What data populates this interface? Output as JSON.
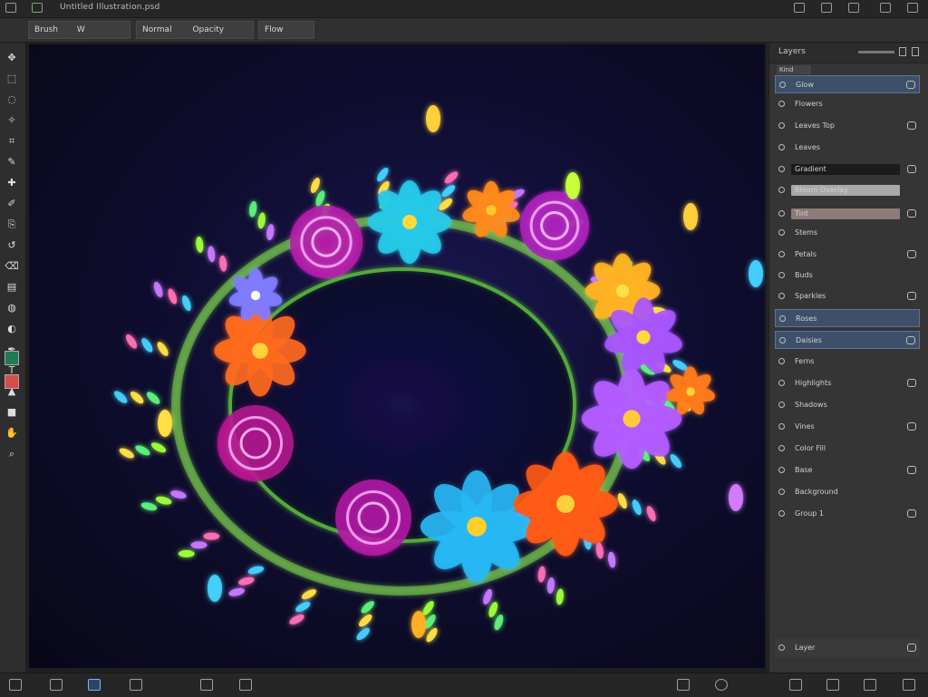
{
  "window": {
    "title": "Untitled Illustration.psd",
    "title_icons": [
      "app-icon",
      "document-icon"
    ],
    "right_icons": [
      "layout-icon",
      "grid-icon",
      "star-icon",
      "download-icon",
      "account-icon"
    ]
  },
  "options_bar": {
    "tool_name": "Brush",
    "size_label": "W",
    "mode_label": "Normal",
    "opacity_label": "Opacity",
    "flow_label": "Flow"
  },
  "toolbox": {
    "tools": [
      "move-tool",
      "marquee-tool",
      "lasso-tool",
      "magic-wand-tool",
      "crop-tool",
      "eyedropper-tool",
      "healing-tool",
      "brush-tool",
      "clone-tool",
      "history-brush-tool",
      "eraser-tool",
      "gradient-tool",
      "blur-tool",
      "dodge-tool",
      "pen-tool",
      "text-tool",
      "path-select-tool",
      "shape-tool",
      "hand-tool",
      "zoom-tool"
    ],
    "foreground_color": "#1f7a55",
    "background_color": "#d84b4b"
  },
  "layers_panel": {
    "title": "Layers",
    "filter_label": "Kind",
    "layers": [
      {
        "name": "Glow",
        "selected": true
      },
      {
        "name": "Flowers"
      },
      {
        "name": "Leaves Top"
      },
      {
        "name": "Leaves"
      },
      {
        "name": "Gradient",
        "bar_color": "#1b1b1b"
      },
      {
        "name": "Bloom Overlay",
        "bar_color": "#a8a8a8"
      },
      {
        "name": "Tint",
        "bar_color": "#8c7b78"
      },
      {
        "name": "Stems"
      },
      {
        "name": "Petals"
      },
      {
        "name": "Buds"
      },
      {
        "name": "Sparkles"
      },
      {
        "name": "Roses",
        "selected": true
      },
      {
        "name": "Daisies",
        "selected": true
      },
      {
        "name": "Ferns"
      },
      {
        "name": "Highlights"
      },
      {
        "name": "Shadows"
      },
      {
        "name": "Vines"
      },
      {
        "name": "Color Fill"
      },
      {
        "name": "Base"
      },
      {
        "name": "Background"
      },
      {
        "name": "Group 1"
      }
    ],
    "footer_label": "Layer"
  },
  "status_bar": {
    "left_icons": [
      "document-icon",
      "image-icon",
      "layers-icon",
      "history-icon",
      "frame-icon",
      "text-icon"
    ],
    "mid_icons": [
      "mask-icon",
      "adjust-icon"
    ],
    "right_icons": [
      "grid-icon",
      "layout-icon",
      "settings-icon",
      "export-icon"
    ]
  },
  "colors": {
    "accent": "#3e5069",
    "canvas_bg": "#0f0d30"
  }
}
